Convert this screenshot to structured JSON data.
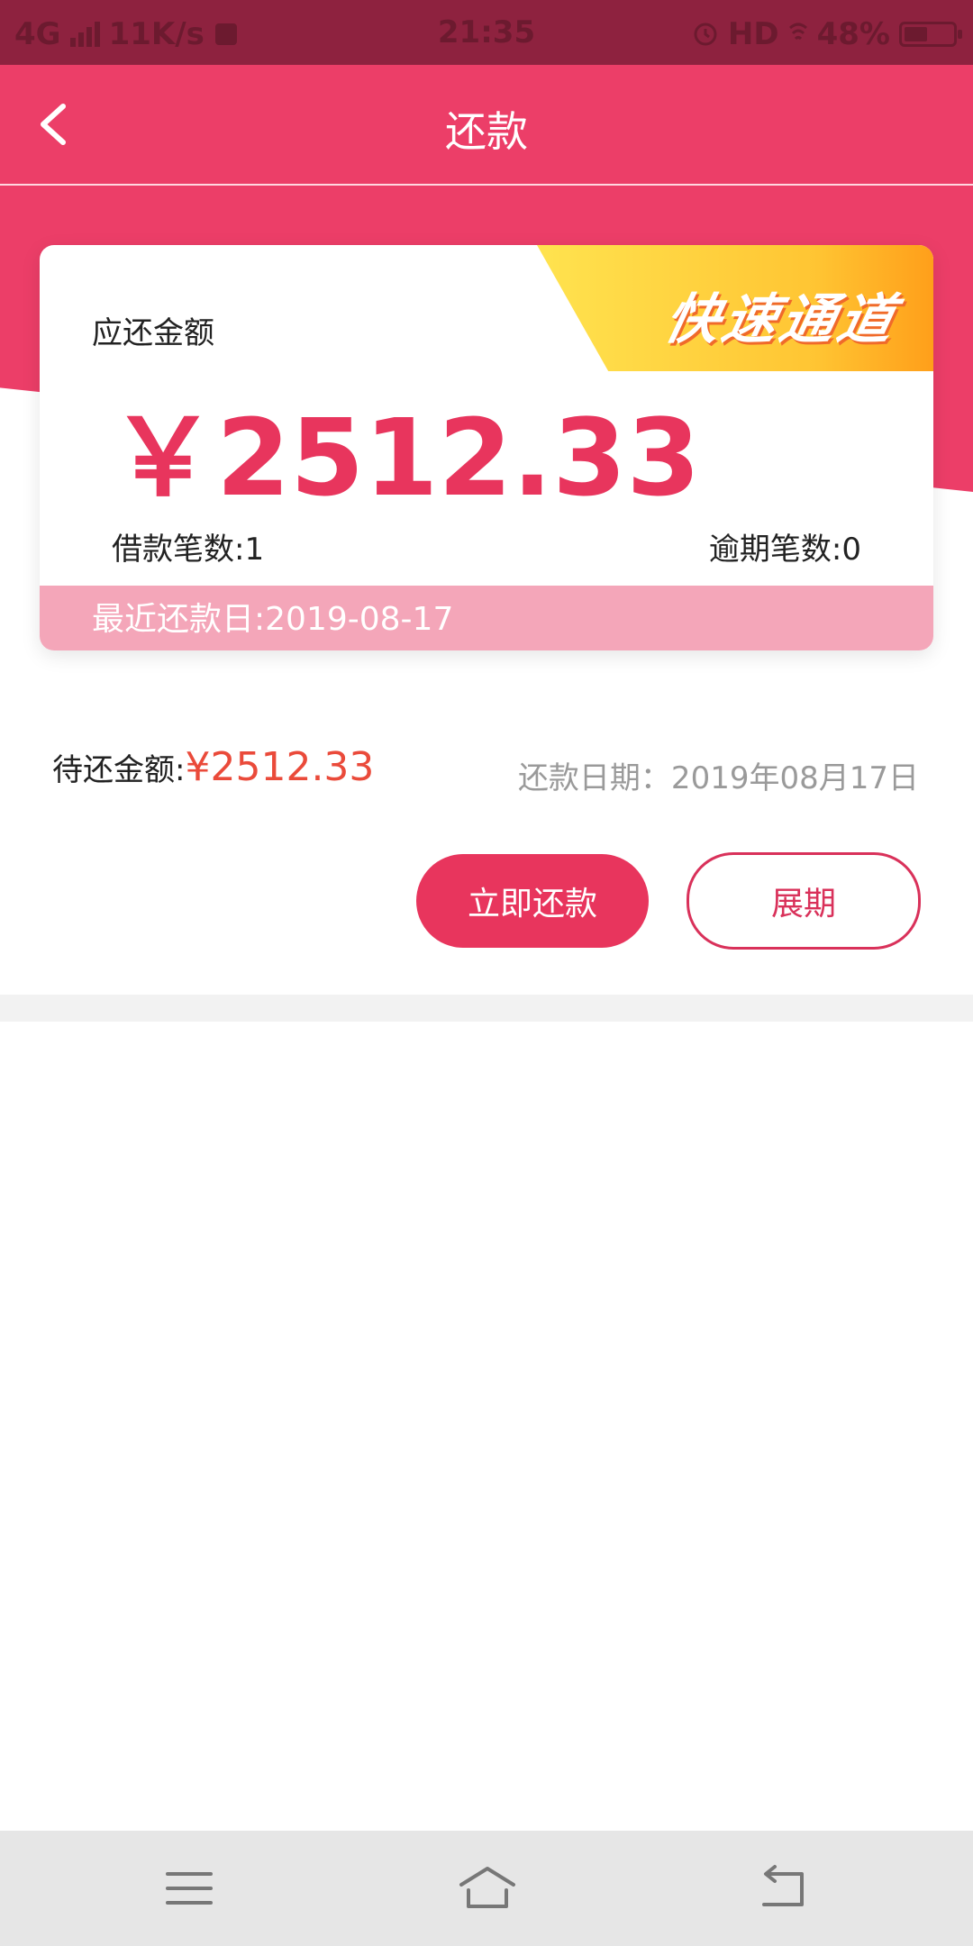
{
  "status_bar": {
    "network": "4G",
    "speed": "11K/s",
    "time": "21:35",
    "hd": "HD",
    "battery": "48%",
    "battery_level": 0.48
  },
  "header": {
    "title": "还款",
    "back_icon": "chevron-left-icon"
  },
  "card": {
    "due_label": "应还金额",
    "due_amount": "￥2512.33",
    "badge": "快速通道",
    "loan_count": "借款笔数:1",
    "overdue_count": "逾期笔数:0",
    "recent_date": "最近还款日:2019-08-17"
  },
  "pending": {
    "label": "待还金额:",
    "amount": "¥2512.33",
    "date": "还款日期：2019年08月17日"
  },
  "actions": {
    "repay_label": "立即还款",
    "extend_label": "展期"
  },
  "system_nav": {
    "menu_icon": "menu-icon",
    "home_icon": "home-icon",
    "back_icon": "back-icon"
  },
  "colors": {
    "brand": "#ec3e68",
    "status_bar": "#8e223f",
    "amount_text": "#e8355d",
    "pending_amount": "#ea4a3a",
    "strip": "#f4a6b9",
    "badge_yellow": "#ffd23a"
  }
}
